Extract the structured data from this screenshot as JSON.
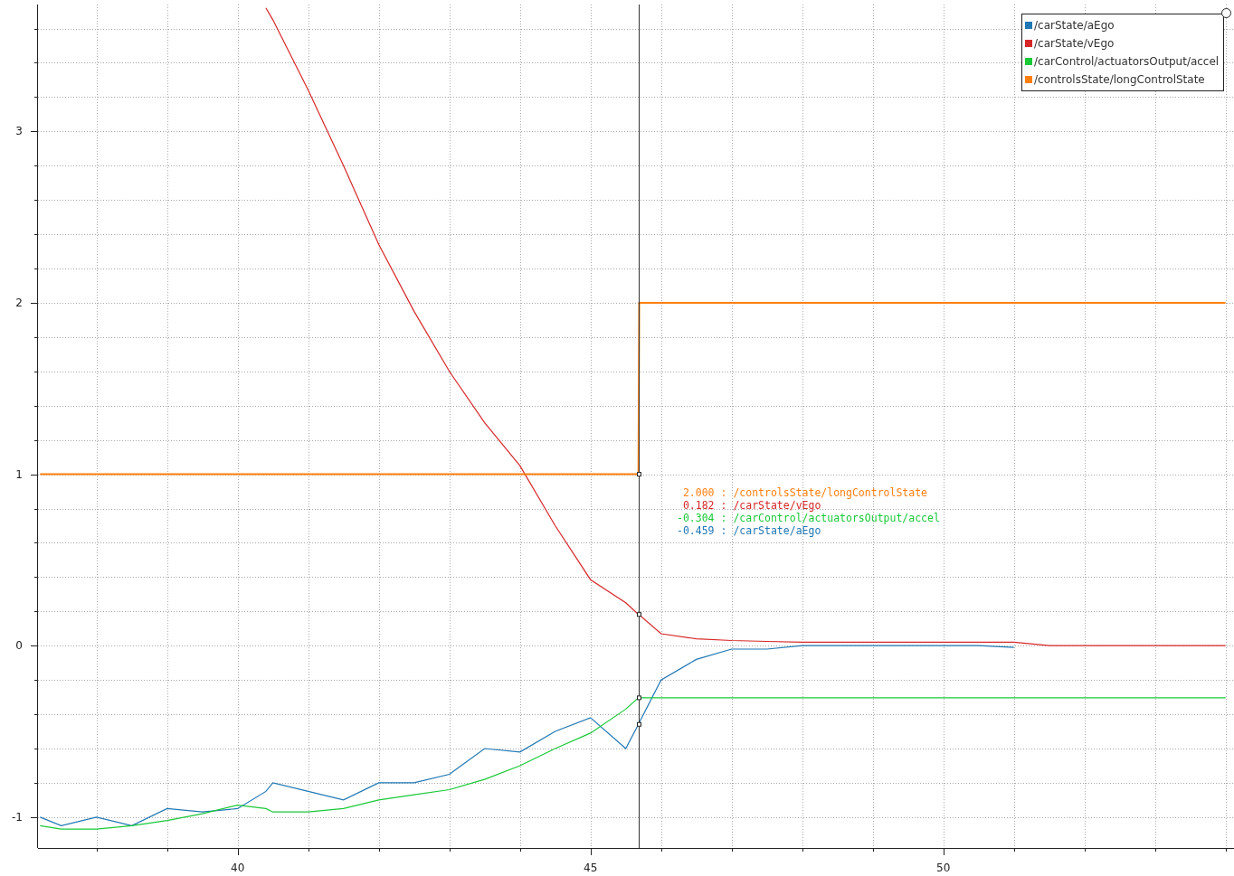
{
  "tracker": [
    {
      "value": "2.000 :",
      "name": "/controlsState/longControlState",
      "color": "#ff7f0e"
    },
    {
      "value": "0.182 :",
      "name": "/carState/vEgo",
      "color": "#d62728"
    },
    {
      "value": "-0.304 :",
      "name": "/carControl/actuatorsOutput/accel",
      "color": "#1ac938"
    },
    {
      "value": "-0.459 :",
      "name": "/carState/aEgo",
      "color": "#1f77b4"
    }
  ],
  "chart_data": {
    "type": "line",
    "grid": true,
    "xlim": [
      37.17,
      54.12
    ],
    "ylim": [
      -1.18,
      3.74
    ],
    "xticks": [
      40,
      45,
      50
    ],
    "yticks": [
      -1,
      0,
      1,
      2,
      3
    ],
    "x": [
      37.2,
      37.5,
      38,
      38.5,
      39,
      39.5,
      40,
      40.4,
      40.5,
      41,
      41.5,
      42,
      42.5,
      43,
      43.5,
      44,
      44.5,
      45,
      45.5,
      45.68,
      45.69,
      46,
      46.5,
      47,
      47.5,
      48,
      48.5,
      49,
      49.5,
      50,
      50.5,
      51,
      51.5,
      52,
      52.5,
      53,
      53.5,
      54
    ],
    "series": [
      {
        "name": "/carState/aEgo",
        "color": "#1f77b4",
        "values": [
          -1.0,
          -1.05,
          -1.0,
          -1.05,
          -0.95,
          -0.97,
          -0.95,
          -0.85,
          -0.8,
          -0.85,
          -0.9,
          -0.8,
          -0.8,
          -0.75,
          -0.6,
          -0.62,
          -0.5,
          -0.42,
          -0.6,
          -0.459,
          -0.45,
          -0.2,
          -0.08,
          -0.02,
          -0.02,
          0.0,
          0.0,
          0.0,
          0.0,
          0.0,
          0.0,
          -0.01,
          null,
          null,
          null,
          null,
          null,
          null
        ]
      },
      {
        "name": "/carState/vEgo",
        "color": "#d62728",
        "values": [
          null,
          null,
          null,
          null,
          null,
          null,
          null,
          3.72,
          3.65,
          3.24,
          2.8,
          2.34,
          1.95,
          1.6,
          1.3,
          1.05,
          0.7,
          0.385,
          0.25,
          0.182,
          0.18,
          0.07,
          0.04,
          0.03,
          0.025,
          0.02,
          0.02,
          0.02,
          0.02,
          0.02,
          0.02,
          0.02,
          0.0,
          0.0,
          0.0,
          0.0,
          0.0,
          0.0
        ]
      },
      {
        "name": "/carControl/actuatorsOutput/accel",
        "color": "#1ac938",
        "values": [
          -1.05,
          -1.07,
          -1.07,
          -1.05,
          -1.02,
          -0.98,
          -0.93,
          -0.95,
          -0.97,
          -0.97,
          -0.95,
          -0.9,
          -0.87,
          -0.84,
          -0.78,
          -0.7,
          -0.6,
          -0.51,
          -0.37,
          -0.304,
          -0.304,
          -0.304,
          -0.304,
          -0.304,
          -0.304,
          -0.304,
          -0.304,
          -0.304,
          -0.304,
          -0.304,
          -0.304,
          -0.304,
          -0.304,
          -0.304,
          -0.304,
          -0.304,
          -0.304,
          -0.304
        ]
      },
      {
        "name": "/controlsState/longControlState",
        "color": "#ff7f0e",
        "values": [
          1,
          1,
          1,
          1,
          1,
          1,
          1,
          1,
          1,
          1,
          1,
          1,
          1,
          1,
          1,
          1,
          1,
          1,
          1,
          1,
          2,
          2,
          2,
          2,
          2,
          2,
          2,
          2,
          2,
          2,
          2,
          2,
          2,
          2,
          2,
          2,
          2,
          2
        ]
      }
    ],
    "ref_lines": [
      {
        "axis": "x",
        "value": 45.68
      }
    ]
  }
}
